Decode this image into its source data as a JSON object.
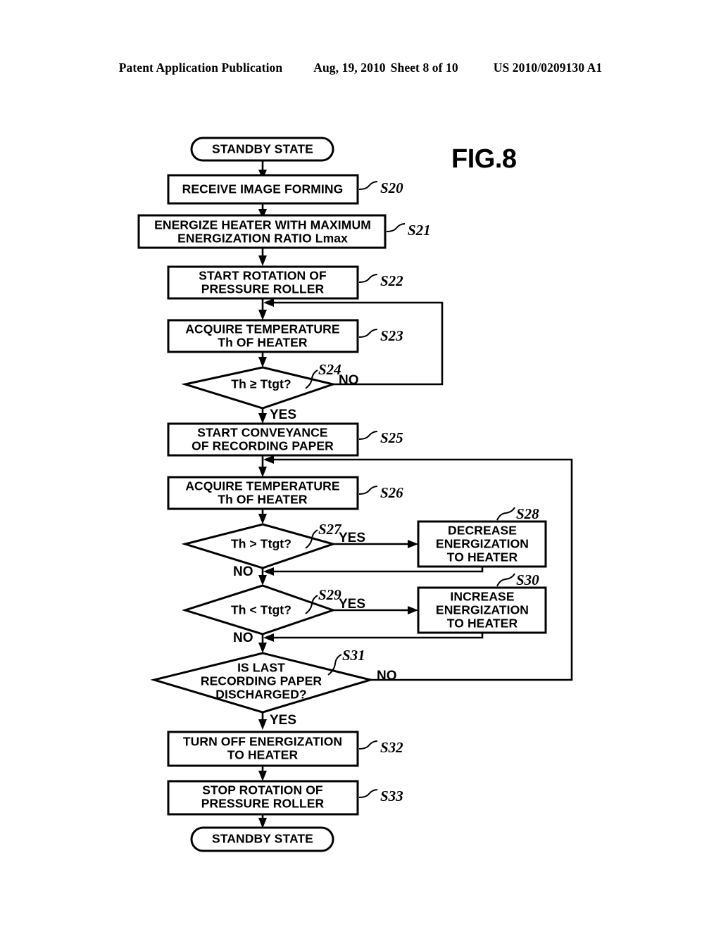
{
  "header": {
    "publication": "Patent Application Publication",
    "date": "Aug, 19, 2010",
    "sheet": "Sheet 8 of 10",
    "document_number": "US 2010/0209130 A1"
  },
  "figure": {
    "label": "FIG.8",
    "type": "flowchart",
    "title": "Fixing device heater energization control flow"
  },
  "colors": {
    "ink": "#000000",
    "paper": "#ffffff"
  },
  "chart_data": {
    "type": "diagram",
    "nodes": [
      {
        "id": "start",
        "shape": "terminator",
        "step": "",
        "lines": [
          "STANDBY STATE"
        ]
      },
      {
        "id": "s20",
        "shape": "process",
        "step": "S20",
        "lines": [
          "RECEIVE IMAGE FORMING"
        ]
      },
      {
        "id": "s21",
        "shape": "process",
        "step": "S21",
        "lines": [
          "ENERGIZE HEATER WITH MAXIMUM",
          "ENERGIZATION RATIO Lmax"
        ]
      },
      {
        "id": "s22",
        "shape": "process",
        "step": "S22",
        "lines": [
          "START ROTATION OF",
          "PRESSURE ROLLER"
        ]
      },
      {
        "id": "s23",
        "shape": "process",
        "step": "S23",
        "lines": [
          "ACQUIRE TEMPERATURE",
          "Th OF HEATER"
        ]
      },
      {
        "id": "s24",
        "shape": "decision",
        "step": "S24",
        "lines": [
          "Th ≥ Ttgt?"
        ]
      },
      {
        "id": "s25",
        "shape": "process",
        "step": "S25",
        "lines": [
          "START CONVEYANCE",
          "OF RECORDING PAPER"
        ]
      },
      {
        "id": "s26",
        "shape": "process",
        "step": "S26",
        "lines": [
          "ACQUIRE TEMPERATURE",
          "Th OF HEATER"
        ]
      },
      {
        "id": "s27",
        "shape": "decision",
        "step": "S27",
        "lines": [
          "Th > Ttgt?"
        ]
      },
      {
        "id": "s28",
        "shape": "process",
        "step": "S28",
        "lines": [
          "DECREASE",
          "ENERGIZATION",
          "TO HEATER"
        ]
      },
      {
        "id": "s29",
        "shape": "decision",
        "step": "S29",
        "lines": [
          "Th < Ttgt?"
        ]
      },
      {
        "id": "s30",
        "shape": "process",
        "step": "S30",
        "lines": [
          "INCREASE",
          "ENERGIZATION",
          "TO HEATER"
        ]
      },
      {
        "id": "s31",
        "shape": "decision",
        "step": "S31",
        "lines": [
          "IS LAST",
          "RECORDING PAPER",
          "DISCHARGED?"
        ]
      },
      {
        "id": "s32",
        "shape": "process",
        "step": "S32",
        "lines": [
          "TURN OFF ENERGIZATION",
          "TO HEATER"
        ]
      },
      {
        "id": "s33",
        "shape": "process",
        "step": "S33",
        "lines": [
          "STOP ROTATION OF",
          "PRESSURE ROLLER"
        ]
      },
      {
        "id": "end",
        "shape": "terminator",
        "step": "",
        "lines": [
          "STANDBY STATE"
        ]
      }
    ],
    "edges": [
      {
        "from": "start",
        "to": "s20",
        "label": ""
      },
      {
        "from": "s20",
        "to": "s21",
        "label": ""
      },
      {
        "from": "s21",
        "to": "s22",
        "label": ""
      },
      {
        "from": "s22",
        "to": "s23",
        "label": ""
      },
      {
        "from": "s23",
        "to": "s24",
        "label": ""
      },
      {
        "from": "s24",
        "to": "s25",
        "label": "YES"
      },
      {
        "from": "s24",
        "to": "s23",
        "label": "NO"
      },
      {
        "from": "s25",
        "to": "s26",
        "label": ""
      },
      {
        "from": "s26",
        "to": "s27",
        "label": ""
      },
      {
        "from": "s27",
        "to": "s28",
        "label": "YES"
      },
      {
        "from": "s27",
        "to": "s29",
        "label": "NO"
      },
      {
        "from": "s28",
        "to": "s29",
        "label": ""
      },
      {
        "from": "s29",
        "to": "s30",
        "label": "YES"
      },
      {
        "from": "s29",
        "to": "s31",
        "label": "NO"
      },
      {
        "from": "s30",
        "to": "s31",
        "label": ""
      },
      {
        "from": "s31",
        "to": "s32",
        "label": "YES"
      },
      {
        "from": "s31",
        "to": "s26",
        "label": "NO"
      },
      {
        "from": "s32",
        "to": "s33",
        "label": ""
      },
      {
        "from": "s33",
        "to": "end",
        "label": ""
      }
    ],
    "branch_labels": {
      "s24_no": "NO",
      "s24_yes": "YES",
      "s27_yes": "YES",
      "s27_no": "NO",
      "s29_yes": "YES",
      "s29_no": "NO",
      "s31_no": "NO",
      "s31_yes": "YES"
    },
    "step_labels": [
      "S20",
      "S21",
      "S22",
      "S23",
      "S24",
      "S25",
      "S26",
      "S27",
      "S28",
      "S29",
      "S30",
      "S31",
      "S32",
      "S33"
    ]
  }
}
